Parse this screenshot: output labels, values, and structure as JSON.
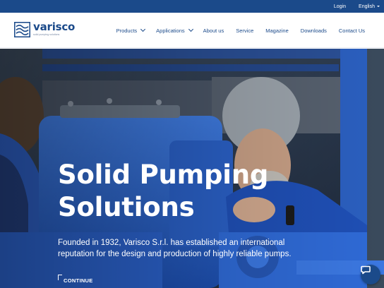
{
  "topbar": {
    "login": "Login",
    "language": "English"
  },
  "header": {
    "logo": {
      "name": "varisco",
      "tagline": "solid pumping solutions"
    },
    "nav": [
      {
        "label": "Products",
        "has_dropdown": true
      },
      {
        "label": "Applications",
        "has_dropdown": true
      },
      {
        "label": "About us",
        "has_dropdown": false
      },
      {
        "label": "Service",
        "has_dropdown": false
      },
      {
        "label": "Magazine",
        "has_dropdown": false
      },
      {
        "label": "Downloads",
        "has_dropdown": false
      },
      {
        "label": "Contact Us",
        "has_dropdown": false
      }
    ]
  },
  "hero": {
    "title_line1": "Solid Pumping",
    "title_line2": "Solutions",
    "subtitle_line1": "Founded in 1932, Varisco S.r.l. has established an international",
    "subtitle_line2": "reputation for the design and production of highly reliable pumps.",
    "cta": "CONTINUE"
  },
  "icons": {
    "chat": "chat-bubble-icon",
    "dropdown": "chevron-down-icon",
    "language_caret": "caret-down-icon"
  },
  "colors": {
    "brand_blue": "#1b4a8a",
    "pump_blue": "#2a63c8",
    "text_white": "#ffffff"
  }
}
